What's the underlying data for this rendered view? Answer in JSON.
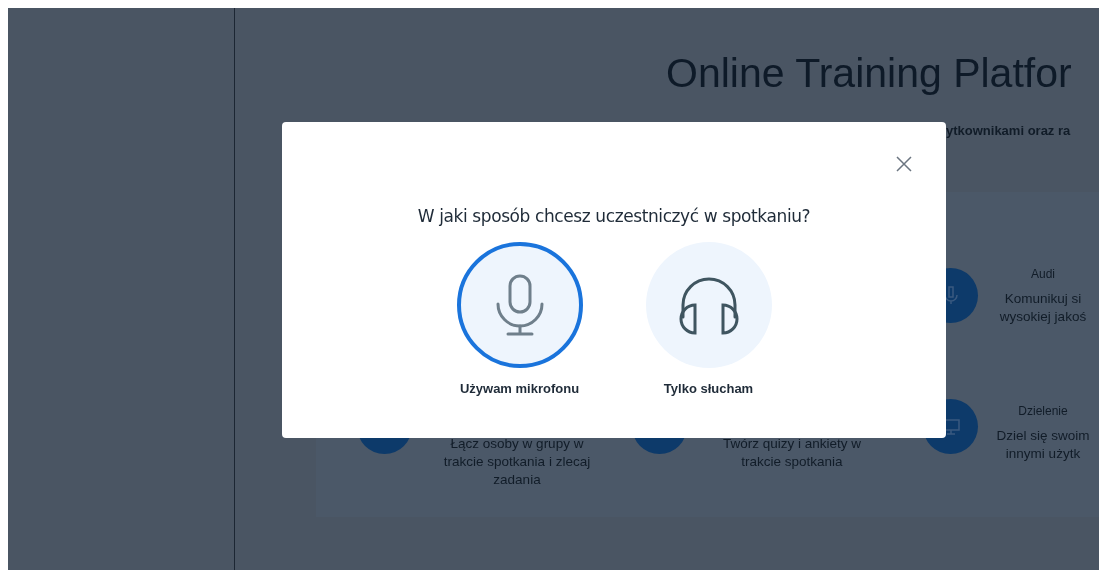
{
  "page": {
    "title": "Online Training Platfor",
    "subtitle": "ytkownikami oraz ra",
    "features": [
      {
        "heading": "Audi",
        "lines": [
          "Komunikuj si",
          "wysokiej jakoś"
        ]
      },
      {
        "lines": [
          "Łącz osoby w grupy w",
          "trakcie spotkania i zlecaj",
          "zadania"
        ]
      },
      {
        "lines": [
          "Twórz quizy i ankiety w",
          "trakcie spotkania"
        ]
      },
      {
        "heading": "Dzielenie",
        "lines": [
          "Dziel się swoim",
          "innymi użytk"
        ]
      }
    ]
  },
  "dialog": {
    "question": "W jaki sposób chcesz uczestniczyć w spotkaniu?",
    "options": [
      {
        "kind": "microphone",
        "label": "Używam mikrofonu",
        "selected": true
      },
      {
        "kind": "headphones",
        "label": "Tylko słucham",
        "selected": false
      }
    ]
  }
}
